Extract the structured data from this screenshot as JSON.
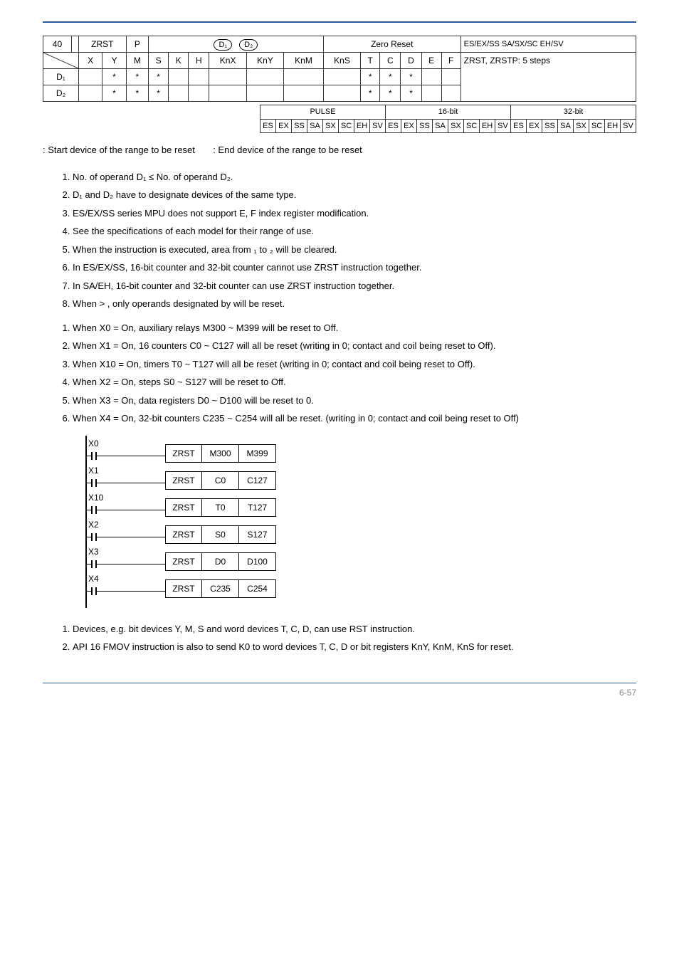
{
  "top_table": {
    "api_num": "40",
    "mnemonic": "ZRST",
    "operand": "P",
    "d1": "D₁",
    "d2": "D₂",
    "function": "Zero Reset",
    "controllers": "ES/EX/SS SA/SX/SC EH/SV",
    "header_cols": [
      "X",
      "Y",
      "M",
      "S",
      "K",
      "H",
      "KnX",
      "KnY",
      "KnM",
      "KnS",
      "T",
      "C",
      "D",
      "E",
      "F"
    ],
    "note": "ZRST, ZRSTP: 5 steps",
    "rows": [
      {
        "label": "D₁",
        "marks": [
          "",
          "*",
          "*",
          "*",
          "",
          "",
          "",
          "",
          "",
          "",
          "*",
          "*",
          "*",
          "",
          ""
        ]
      },
      {
        "label": "D₂",
        "marks": [
          "",
          "*",
          "*",
          "*",
          "",
          "",
          "",
          "",
          "",
          "",
          "*",
          "*",
          "*",
          "",
          ""
        ]
      }
    ]
  },
  "pulse_table": {
    "sec_pulse": "PULSE",
    "sec_16": "16-bit",
    "sec_32": "32-bit",
    "cells": [
      "ES",
      "EX",
      "SS",
      "SA",
      "SX",
      "SC",
      "EH",
      "SV",
      "ES",
      "EX",
      "SS",
      "SA",
      "SX",
      "SC",
      "EH",
      "SV",
      "ES",
      "EX",
      "SS",
      "SA",
      "SX",
      "SC",
      "EH",
      "SV"
    ]
  },
  "operands_line": {
    "l": ": Start device of the range to be reset",
    "r": ": End device of the range to be reset"
  },
  "explanations": [
    "No. of operand D₁ ≤ No. of operand D₂.",
    "D₁ and D₂ have to designate devices of the same type.",
    "ES/EX/SS series MPU does not support E, F index register modification.",
    "See the specifications of each model for their range of use.",
    "When the instruction is executed, area from    ₁ to    ₂ will be cleared.",
    "In ES/EX/SS, 16-bit counter and 32-bit counter cannot use ZRST instruction together.",
    "In SA/EH, 16-bit counter and 32-bit counter can use ZRST instruction together.",
    "When    >   , only operands designated by     will be reset."
  ],
  "program_example": [
    "When X0 = On, auxiliary relays M300 ~ M399 will be reset to Off.",
    "When X1 = On, 16 counters C0 ~ C127 will all be reset (writing in 0; contact and coil being reset to Off).",
    "When X10 = On, timers T0 ~ T127 will all be reset (writing in 0; contact and coil being reset to Off).",
    "When X2 = On, steps S0 ~ S127 will be reset to Off.",
    "When X3 = On, data registers D0 ~ D100 will be reset to 0.",
    "When X4 = On, 32-bit counters C235 ~ C254 will all be reset. (writing in 0; contact and coil being reset to Off)"
  ],
  "ladder": [
    {
      "contact": "X0",
      "op": "ZRST",
      "a": "M300",
      "b": "M399"
    },
    {
      "contact": "X1",
      "op": "ZRST",
      "a": "C0",
      "b": "C127"
    },
    {
      "contact": "X10",
      "op": "ZRST",
      "a": "T0",
      "b": "T127"
    },
    {
      "contact": "X2",
      "op": "ZRST",
      "a": "S0",
      "b": "S127"
    },
    {
      "contact": "X3",
      "op": "ZRST",
      "a": "D0",
      "b": "D100"
    },
    {
      "contact": "X4",
      "op": "ZRST",
      "a": "C235",
      "b": "C254"
    }
  ],
  "remarks": [
    "Devices, e.g. bit devices Y, M, S and word devices T, C, D, can use RST instruction.",
    "API 16 FMOV instruction is also to send K0 to word devices T, C, D or bit registers KnY, KnM, KnS for reset."
  ],
  "pagenum": "6-57"
}
